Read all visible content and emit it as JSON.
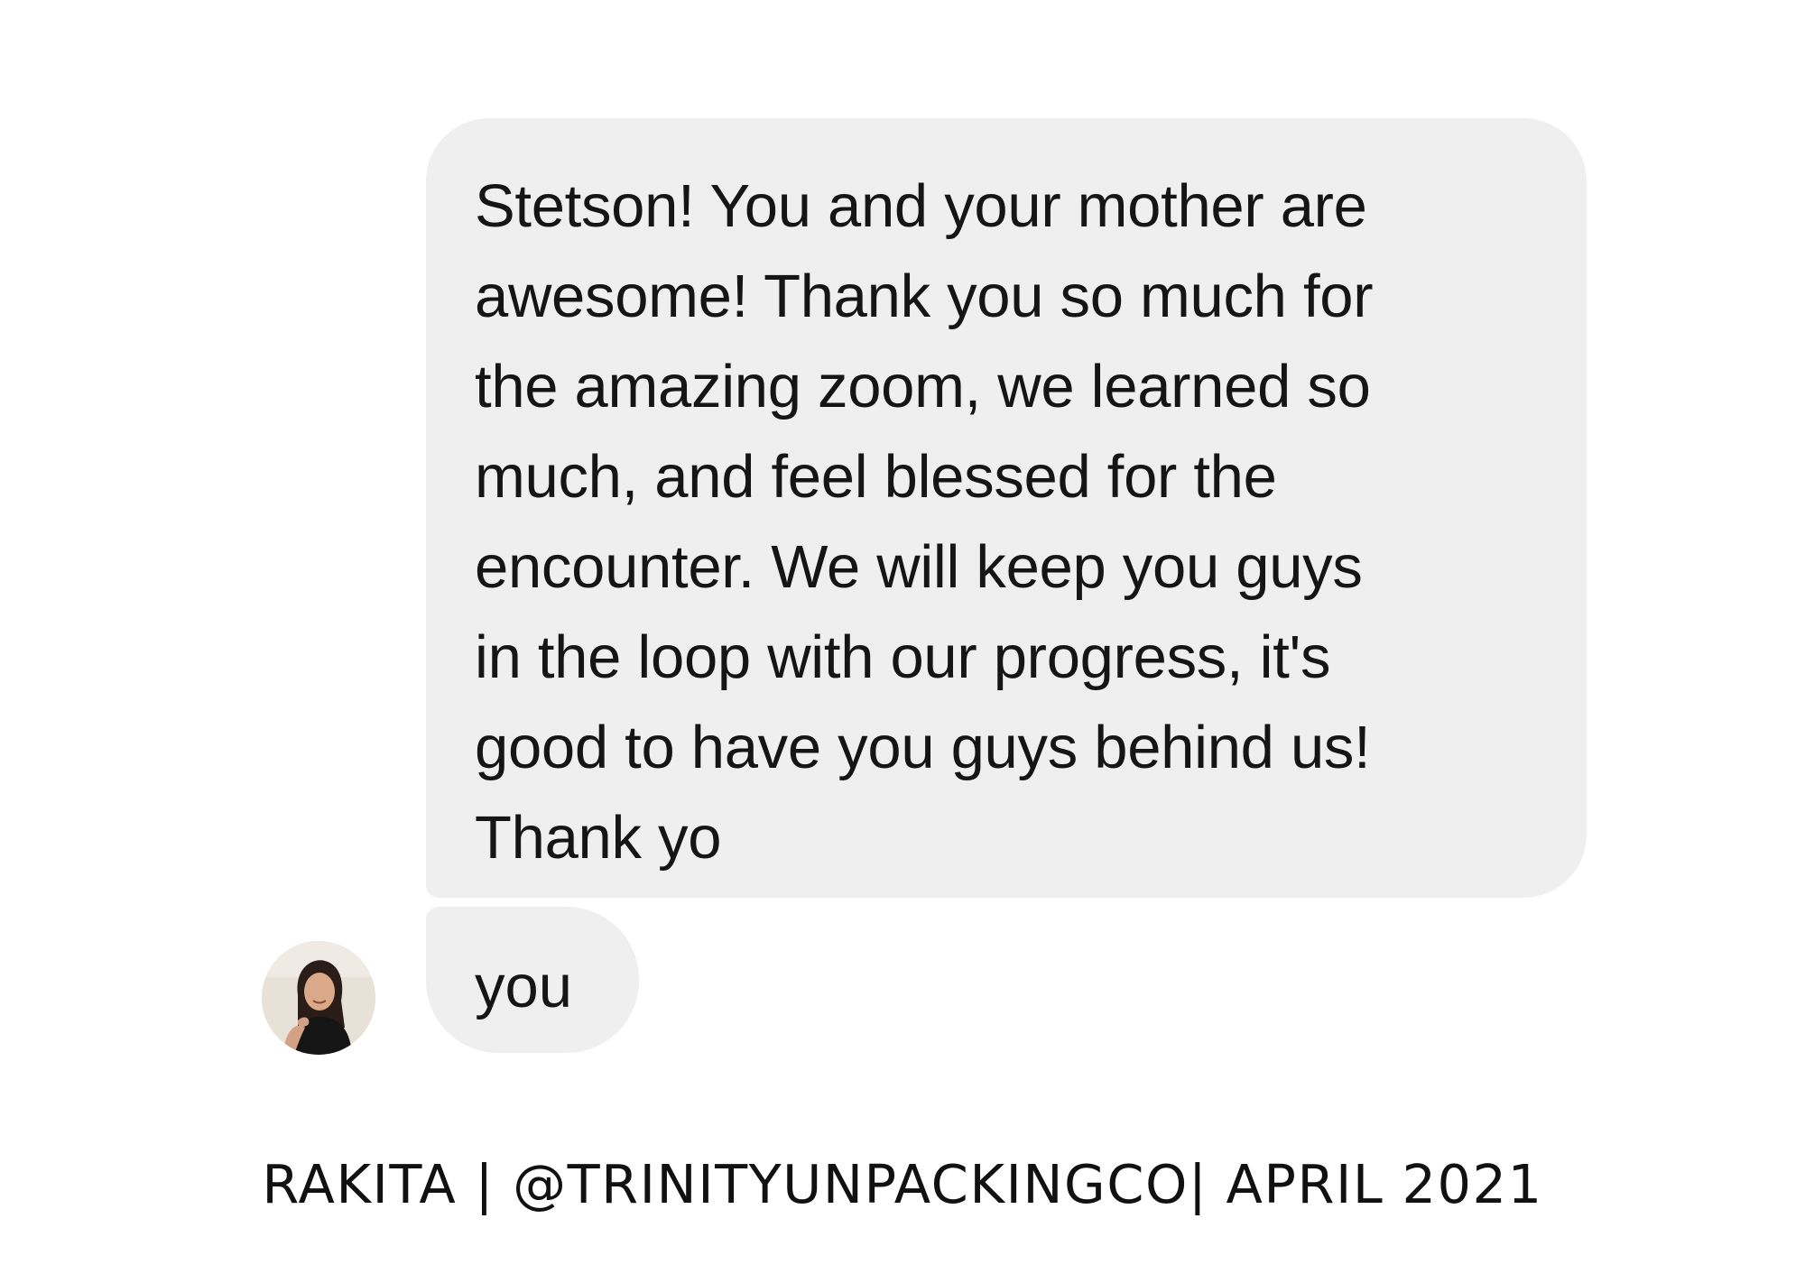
{
  "conversation": {
    "messages": [
      {
        "text": "Stetson! You and your mother are\nawesome! Thank you so much for\nthe amazing zoom, we learned so\nmuch, and feel blessed for the\nencounter. We will keep you guys\nin the loop with our progress, it's\ngood to have you guys behind us!\nThank yo"
      },
      {
        "text": "you"
      }
    ]
  },
  "caption": {
    "text": "RAKITA | @TRINITYUNPACKINGCO| APRIL 2021"
  },
  "colors": {
    "bubble": "#efefef",
    "background": "#ffffff",
    "text": "#151515"
  }
}
